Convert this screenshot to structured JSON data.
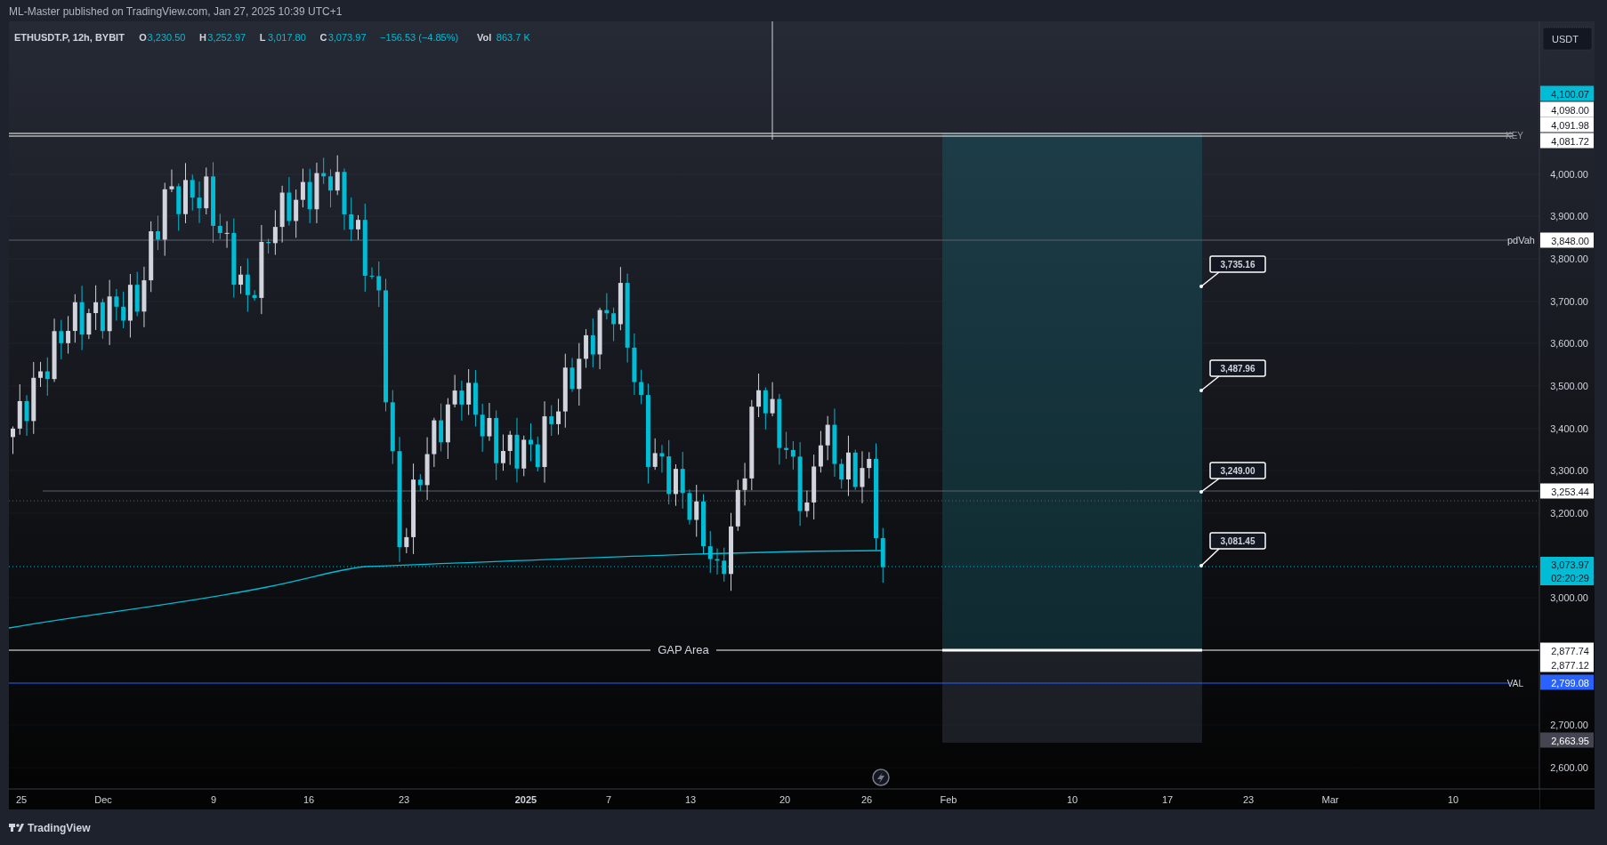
{
  "header": {
    "published": "ML-Master published on TradingView.com, Jan 27, 2025 10:39 UTC+1"
  },
  "legend": {
    "symbol": "ETHUSDT.P, 12h, BYBIT",
    "fields": [
      {
        "label": "O",
        "value": "3,230.50"
      },
      {
        "label": "H",
        "value": "3,252.97"
      },
      {
        "label": "L",
        "value": "3,017.80"
      },
      {
        "label": "C",
        "value": "3,073.97"
      }
    ],
    "change": "−156.53 (−4.85%)",
    "volume": {
      "label": "Vol",
      "value": "863.7 K"
    }
  },
  "currency_button": "USDT",
  "price_axis": {
    "ticks": [
      "4,000.00",
      "3,900.00",
      "3,800.00",
      "3,700.00",
      "3,600.00",
      "3,500.00",
      "3,400.00",
      "3,300.00",
      "3,200.00",
      "3,000.00",
      "2,700.00",
      "2,600.00"
    ]
  },
  "price_tags": [
    {
      "text": "4,100.07",
      "kind": "highlight"
    },
    {
      "text": "4,098.00",
      "kind": "plain"
    },
    {
      "text": "4,091.98",
      "kind": "plain"
    },
    {
      "text": "4,081.72",
      "kind": "plain"
    },
    {
      "text": "3,848.00",
      "kind": "plain"
    },
    {
      "text": "3,253.44",
      "kind": "plain"
    },
    {
      "text": "3,073.97",
      "kind": "current",
      "countdown": "02:20:29"
    },
    {
      "text": "2,877.74",
      "kind": "plain"
    },
    {
      "text": "2,877.12",
      "kind": "plain"
    },
    {
      "text": "2,799.08",
      "kind": "blue"
    },
    {
      "text": "2,663.95",
      "kind": "grey"
    }
  ],
  "lines": [
    {
      "label": "KEY"
    },
    {
      "label": "pdVah"
    },
    {
      "label": "GAP Area"
    },
    {
      "label": "VAL"
    }
  ],
  "callouts": [
    "3,735.16",
    "3,487.96",
    "3,249.00",
    "3,081.45"
  ],
  "time_axis": {
    "labels": [
      {
        "text": "25",
        "bold": false
      },
      {
        "text": "Dec",
        "bold": false
      },
      {
        "text": "9",
        "bold": false
      },
      {
        "text": "16",
        "bold": false
      },
      {
        "text": "23",
        "bold": false
      },
      {
        "text": "2025",
        "bold": true
      },
      {
        "text": "7",
        "bold": false
      },
      {
        "text": "13",
        "bold": false
      },
      {
        "text": "20",
        "bold": false
      },
      {
        "text": "26",
        "bold": false
      },
      {
        "text": "Feb",
        "bold": false
      },
      {
        "text": "10",
        "bold": false
      },
      {
        "text": "17",
        "bold": false
      },
      {
        "text": "23",
        "bold": false
      },
      {
        "text": "Mar",
        "bold": false
      },
      {
        "text": "10",
        "bold": false
      }
    ]
  },
  "footer": {
    "brand": "TradingView"
  }
}
